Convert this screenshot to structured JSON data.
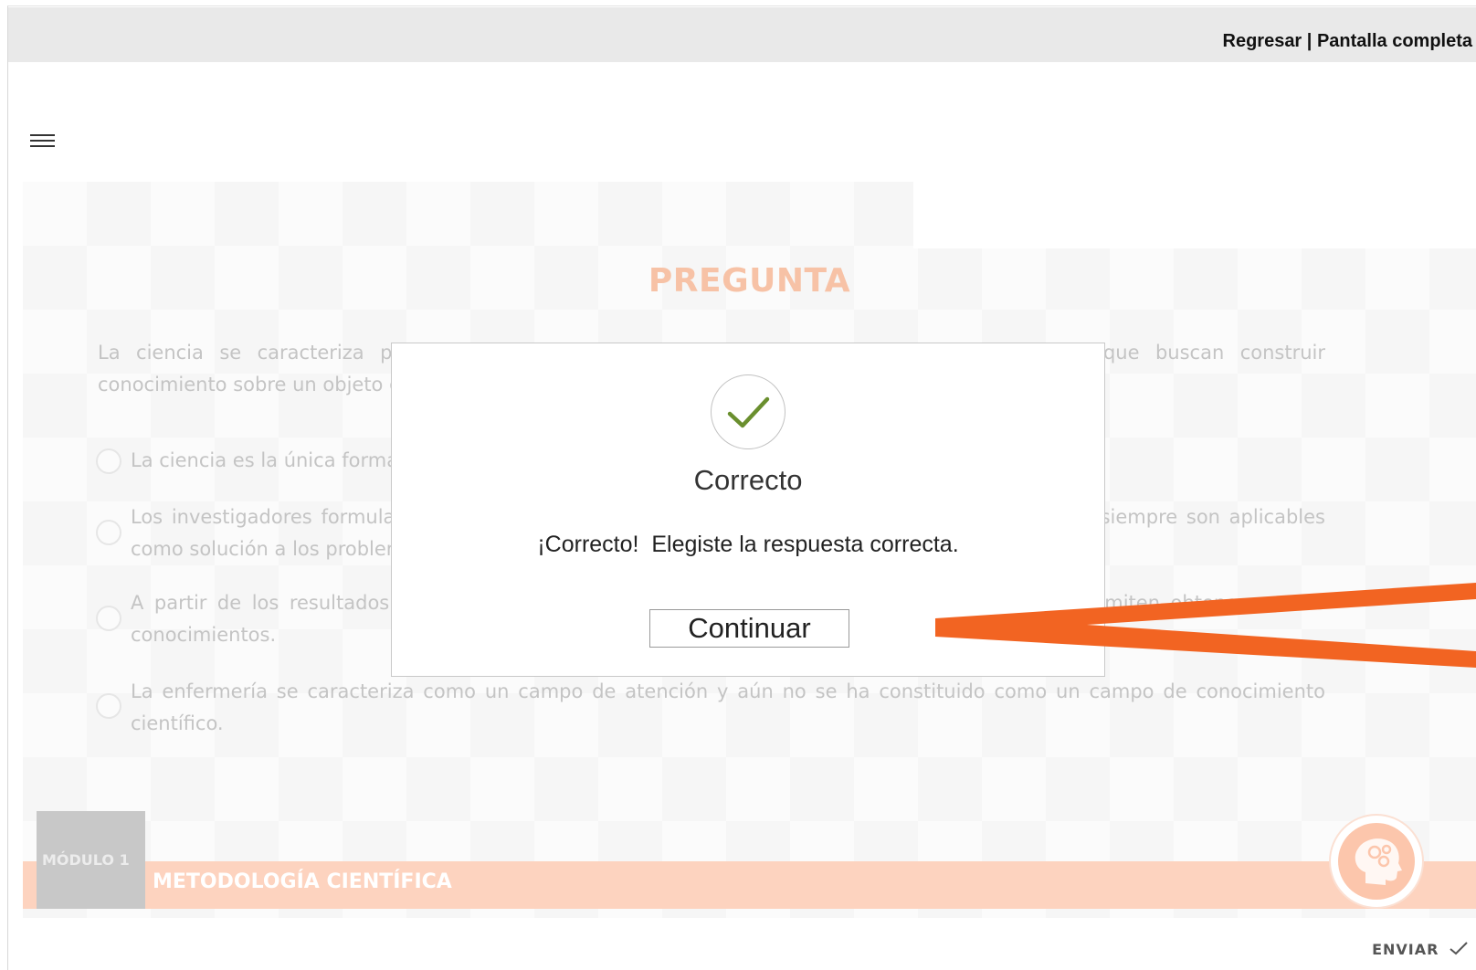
{
  "header": {
    "back_label": "Regresar",
    "separator": " | ",
    "fullscreen_label": "Pantalla completa"
  },
  "question": {
    "title": "PREGUNTA",
    "text_line1": "La ciencia se caracteriza por ser un conjunto de procedimientos lógicos y sistemáticos en que buscan construir",
    "text_line2": "conocimiento sobre un objeto de estudio, ¿Cuál de las siguientes afirmaciones es correcta?",
    "options": [
      {
        "text": "La ciencia es la única forma válida de generar conocimiento sobre la realidad."
      },
      {
        "text": "Los investigadores formulan preguntas de investigación cuyos resultados son conocimientos que siempre son aplicables como solución a los problemas de la práctica."
      },
      {
        "text": "A partir de los resultados de las investigaciones se pueden formular nuevas preguntas que permiten obtener nuevos conocimientos."
      },
      {
        "text": "La enfermería se caracteriza como un campo de atención y aún no se ha constituido como un campo de conocimiento científico."
      }
    ]
  },
  "module": {
    "label": "MÓDULO 1",
    "title": "METODOLOGÍA CIENTÍFICA"
  },
  "footer": {
    "submit_label": "ENVIAR"
  },
  "modal": {
    "title": "Correcto",
    "message": "¡Correcto!  Elegiste la respuesta correcta.",
    "button_label": "Continuar",
    "icon": "check-icon"
  },
  "colors": {
    "accent_orange": "#f26422",
    "title_orange": "#f7c2a6",
    "band_orange": "#fdd3bf",
    "check_green": "#6a8f2e"
  }
}
